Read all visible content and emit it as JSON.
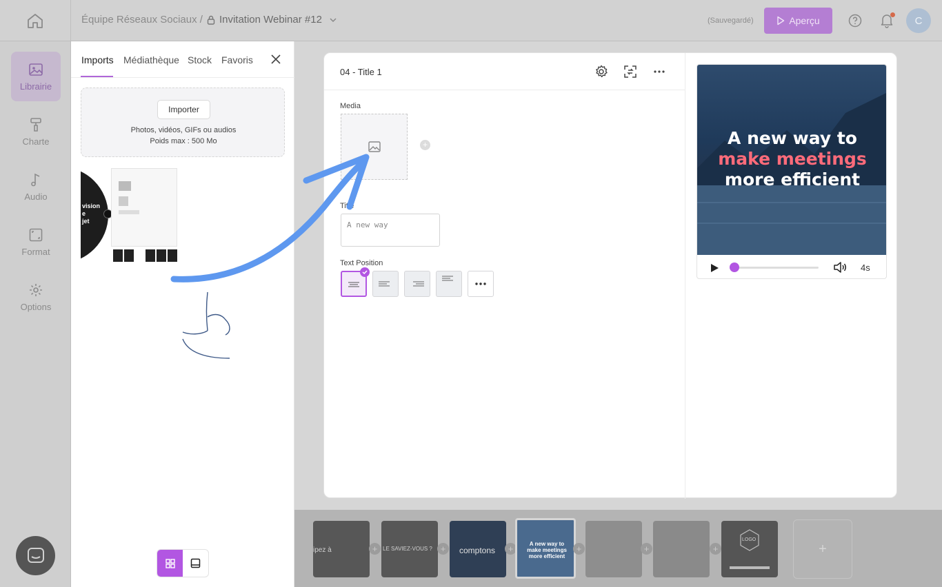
{
  "topbar": {
    "team": "Équipe Réseaux Sociaux /",
    "project": "Invitation Webinar #12",
    "saved": "(Sauvegardé)",
    "preview_button": "Aperçu",
    "avatar_initial": "C"
  },
  "rail": {
    "items": [
      {
        "label": "Librairie",
        "icon": "library-icon"
      },
      {
        "label": "Charte",
        "icon": "paint-roller-icon"
      },
      {
        "label": "Audio",
        "icon": "music-note-icon"
      },
      {
        "label": "Format",
        "icon": "format-icon"
      },
      {
        "label": "Options",
        "icon": "gear-icon"
      }
    ]
  },
  "library": {
    "tabs": [
      "Imports",
      "Médiathèque",
      "Stock",
      "Favoris"
    ],
    "import_button": "Importer",
    "dropzone_line1": "Photos, vidéos, GIFs ou audios",
    "dropzone_line2": "Poids max : 500 Mo",
    "thumb_text": "vision\ne\njet"
  },
  "editor": {
    "slide_title": "04 - Title 1",
    "media_label": "Media",
    "title_label": "Title",
    "title_value": "A new way",
    "text_position_label": "Text Position"
  },
  "preview": {
    "line1": "A new way to",
    "line2": "make meetings",
    "line3": "more efficient",
    "duration": "4s",
    "accent_color": "#b256e2",
    "highlight_color": "#ff6b7a"
  },
  "timeline": {
    "slides": [
      {
        "text": "ipez à"
      },
      {
        "text": "LE SAVIEZ-VOUS ?"
      },
      {
        "text": "comptons"
      },
      {
        "text": "A new way to make meetings more efficient"
      },
      {
        "text": ""
      },
      {
        "text": ""
      },
      {
        "text": "LOGO"
      }
    ],
    "add_label": "+"
  }
}
